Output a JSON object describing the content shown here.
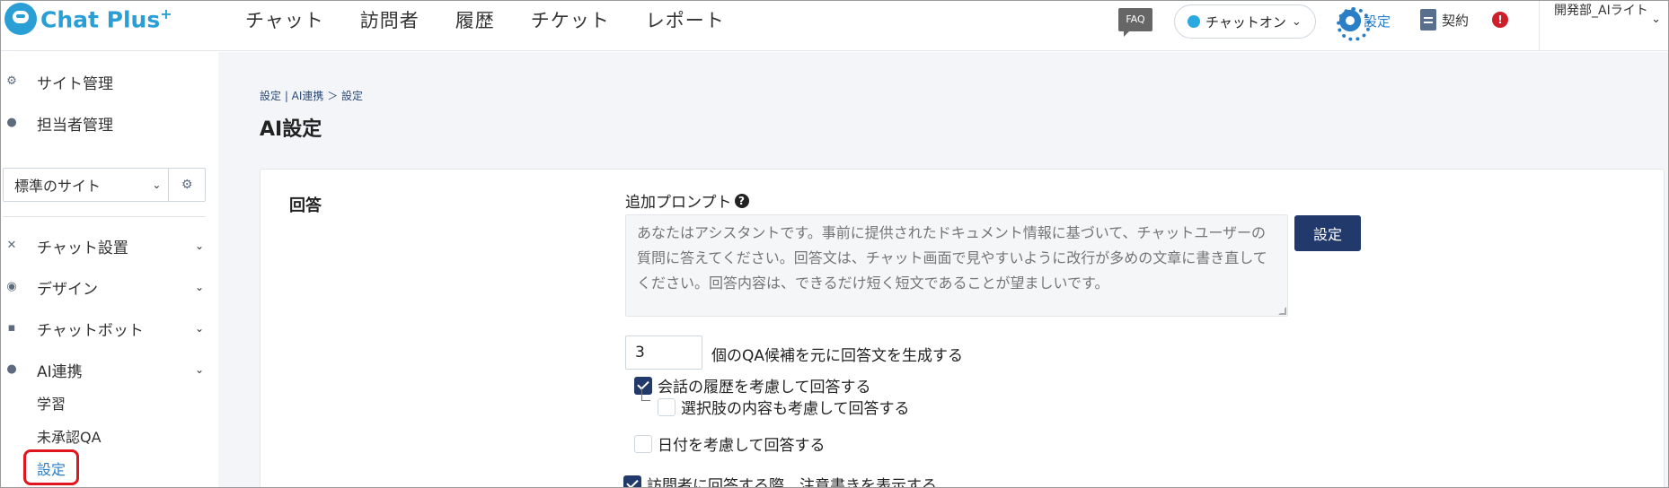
{
  "header": {
    "logo_text": "Chat Plus",
    "logo_plus": "+",
    "nav": [
      "チャット",
      "訪問者",
      "履歴",
      "チケット",
      "レポート"
    ],
    "faq": "FAQ",
    "chat_status": "チャットオン",
    "settings_link": "設定",
    "contract_link": "契約",
    "alert": "!",
    "user_name": "開発部_AIライト"
  },
  "sidebar": {
    "site_manage": "サイト管理",
    "staff_manage": "担当者管理",
    "site_select": "標準のサイト",
    "groups": [
      {
        "label": "チャット設置"
      },
      {
        "label": "デザイン"
      },
      {
        "label": "チャットボット"
      },
      {
        "label": "AI連携"
      }
    ],
    "ai_subitems": [
      "学習",
      "未承認QA",
      "設定"
    ]
  },
  "main": {
    "breadcrumb": "設定 | AI連携 ＞ 設定",
    "page_title": "AI設定",
    "section_label": "回答",
    "prompt_label": "追加プロンプト",
    "prompt_placeholder": "あなたはアシスタントです。事前に提供されたドキュメント情報に基づいて、チャットユーザーの質問に答えてください。回答文は、チャット画面で見やすいように改行が多めの文章に書き直してください。回答内容は、できるだけ短く短文であることが望ましいです。",
    "set_button": "設定",
    "qa_count": "3",
    "qa_text": "個のQA候補を元に回答文を生成する",
    "options": [
      {
        "label": "会話の履歴を考慮して回答する",
        "checked": true
      },
      {
        "label": "選択肢の内容も考慮して回答する",
        "checked": false
      },
      {
        "label": "日付を考慮して回答する",
        "checked": false
      },
      {
        "label": "訪問者に回答する際、注意書きを表示する",
        "checked": true
      }
    ]
  },
  "colors": {
    "brand": "#2a9fd6",
    "primary_button": "#22396b",
    "link": "#2a7ec6",
    "alert": "#cc1f2a",
    "highlight": "#e0161e"
  }
}
